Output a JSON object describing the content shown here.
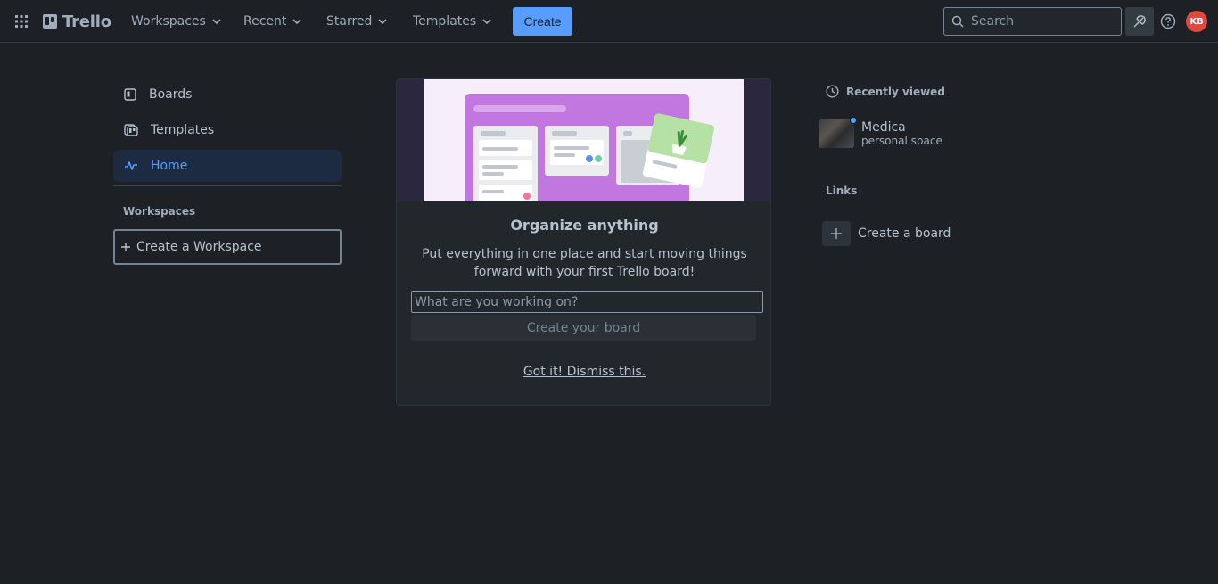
{
  "header": {
    "logo_text": "Trello",
    "nav": {
      "workspaces": "Workspaces",
      "recent": "Recent",
      "starred": "Starred",
      "templates": "Templates"
    },
    "create_label": "Create",
    "search_placeholder": "Search",
    "avatar_initials": "KB",
    "accent_color": "#579dff",
    "avatar_color": "#e2483d"
  },
  "sidebar": {
    "items": [
      {
        "label": "Boards",
        "icon": "board-icon"
      },
      {
        "label": "Templates",
        "icon": "template-icon"
      },
      {
        "label": "Home",
        "icon": "activity-icon",
        "active": true
      }
    ],
    "workspaces_heading": "Workspaces",
    "create_workspace_label": "Create a Workspace"
  },
  "onboarding": {
    "title": "Organize anything",
    "description": "Put everything in one place and start moving things forward with your first Trello board!",
    "input_placeholder": "What are you working on?",
    "create_label": "Create your board",
    "dismiss_label": "Got it! Dismiss this."
  },
  "right_panel": {
    "recently_viewed_heading": "Recently viewed",
    "recent_boards": [
      {
        "name": "Medica",
        "subtitle": "personal space"
      }
    ],
    "links_heading": "Links",
    "create_board_label": "Create a board"
  }
}
